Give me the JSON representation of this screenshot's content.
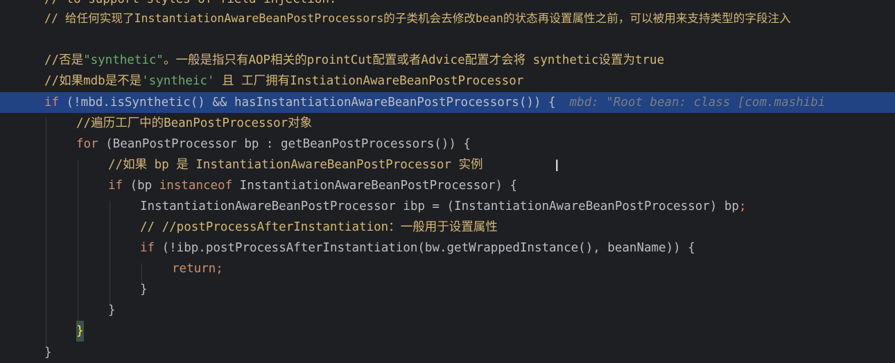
{
  "lines": [
    {
      "text": "// to support styles of field injection."
    },
    {
      "text": "// 给任何实现了InstantiationAwareBeanPostProcessors的子类机会去修改bean的状态再设置属性之前，可以被用来支持类型的字段注入"
    },
    {
      "text": ""
    },
    {
      "text": "//否是\"synthetic\"。一般是指只有AOP相关的prointCut配置或者Advice配置才会将 synthetic设置为true"
    },
    {
      "text": "//如果mdb是不是'syntheic' 且 工厂拥有InstiationAwareBeanPostProcessor"
    },
    {
      "text": "if (!mbd.isSynthetic() && hasInstantiationAwareBeanPostProcessors()) {",
      "hint": "mbd: \"Root bean: class [com.mashibi"
    },
    {
      "text": "//遍历工厂中的BeanPostProcessor对象"
    },
    {
      "text": "for (BeanPostProcessor bp : getBeanPostProcessors()) {"
    },
    {
      "text": "//如果 bp 是 InstantiationAwareBeanPostProcessor 实例"
    },
    {
      "text": "if (bp instanceof InstantiationAwareBeanPostProcessor) {"
    },
    {
      "text": "InstantiationAwareBeanPostProcessor ibp = (InstantiationAwareBeanPostProcessor) bp;"
    },
    {
      "text": "// //postProcessAfterInstantiation：一般用于设置属性"
    },
    {
      "text": "if (!ibp.postProcessAfterInstantiation(bw.getWrappedInstance(), beanName)) {"
    },
    {
      "text": "return;"
    },
    {
      "text": "}"
    },
    {
      "text": "}"
    },
    {
      "text": "}"
    },
    {
      "text": "}"
    }
  ],
  "colors": {
    "background": "#1e1f22",
    "highlight_line": "#214283",
    "keyword": "#cf8e6d",
    "comment": "#7a7e85",
    "comment_cjk": "#d5b778",
    "string": "#6aab73",
    "text": "#bcbec4"
  },
  "icons": {
    "caret": "text-cursor-icon"
  }
}
